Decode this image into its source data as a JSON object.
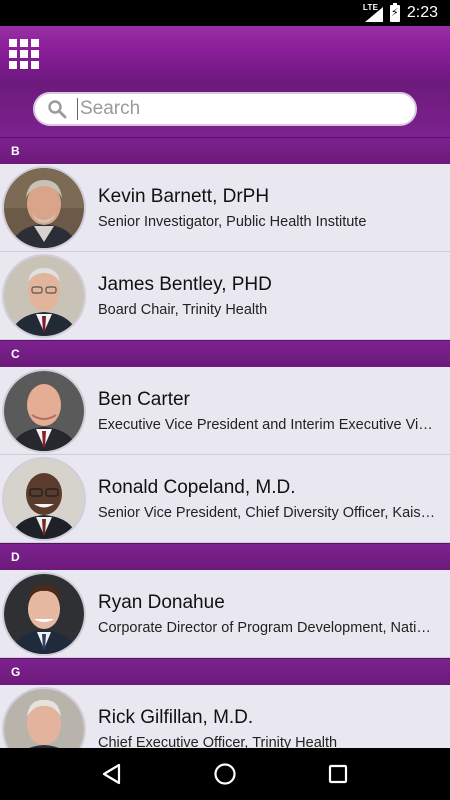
{
  "status_bar": {
    "network": "LTE",
    "time": "2:23"
  },
  "search": {
    "placeholder": "Search",
    "value": ""
  },
  "sections": [
    {
      "letter": "B",
      "people": [
        {
          "name": "Kevin Barnett, DrPH",
          "title": "Senior Investigator, Public Health Institute"
        },
        {
          "name": "James Bentley, PHD",
          "title": "Board Chair, Trinity Health"
        }
      ]
    },
    {
      "letter": "C",
      "people": [
        {
          "name": "Ben Carter",
          "title": "Executive Vice President and Interim Executive Vice President and Chief Financial Officer"
        },
        {
          "name": "Ronald Copeland, M.D.",
          "title": "Senior Vice President, Chief Diversity Officer, Kaiser Permanente"
        }
      ]
    },
    {
      "letter": "D",
      "people": [
        {
          "name": "Ryan Donahue",
          "title": "Corporate Director of Program Development, National"
        }
      ]
    },
    {
      "letter": "G",
      "people": [
        {
          "name": "Rick Gilfillan, M.D.",
          "title": "Chief Executive Officer, Trinity Health"
        }
      ]
    }
  ],
  "colors": {
    "accent": "#7d2290",
    "row_bg": "#e9e8f0"
  }
}
